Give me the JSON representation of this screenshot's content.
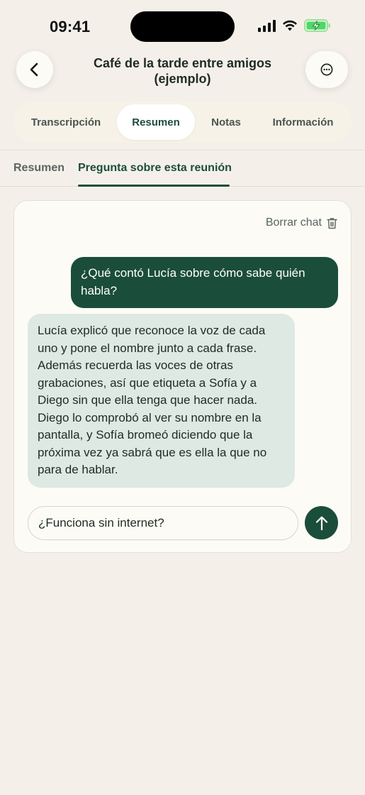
{
  "status_bar": {
    "time": "09:41",
    "icons": [
      "signal-icon",
      "wifi-icon",
      "battery-charging-icon"
    ],
    "battery_color": "#4cd964"
  },
  "header": {
    "title_line1": "Café de la tarde entre amigos",
    "title_line2": "(ejemplo)",
    "back_icon": "chevron-left-icon",
    "more_icon": "more-circle-icon"
  },
  "tabs": [
    {
      "label": "Transcripción",
      "active": false
    },
    {
      "label": "Resumen",
      "active": true
    },
    {
      "label": "Notas",
      "active": false
    },
    {
      "label": "Información",
      "active": false
    }
  ],
  "subtabs": [
    {
      "label": "Resumen",
      "active": false
    },
    {
      "label": "Pregunta sobre esta reunión",
      "active": true
    }
  ],
  "chat": {
    "clear_label": "Borrar chat",
    "clear_icon": "trash-icon",
    "messages": [
      {
        "role": "user",
        "text": "¿Qué contó Lucía sobre cómo sabe quién habla?"
      },
      {
        "role": "assistant",
        "text": "Lucía explicó que reconoce la voz de cada uno y pone el nombre junto a cada frase. Además recuerda las voces de otras grabaciones, así que etiqueta a Sofía y a Diego sin que ella tenga que hacer nada. Diego lo comprobó al ver su nombre en la pantalla, y Sofía bromeó diciendo que la próxima vez ya sabrá que es ella la que no para de hablar."
      }
    ],
    "input_value": "¿Funciona sin internet?",
    "send_icon": "arrow-up-icon"
  },
  "colors": {
    "accent": "#1b4d3b",
    "background": "#f4f0e9",
    "assistant_bubble": "#dde9e2",
    "card": "#fdfbf5"
  }
}
